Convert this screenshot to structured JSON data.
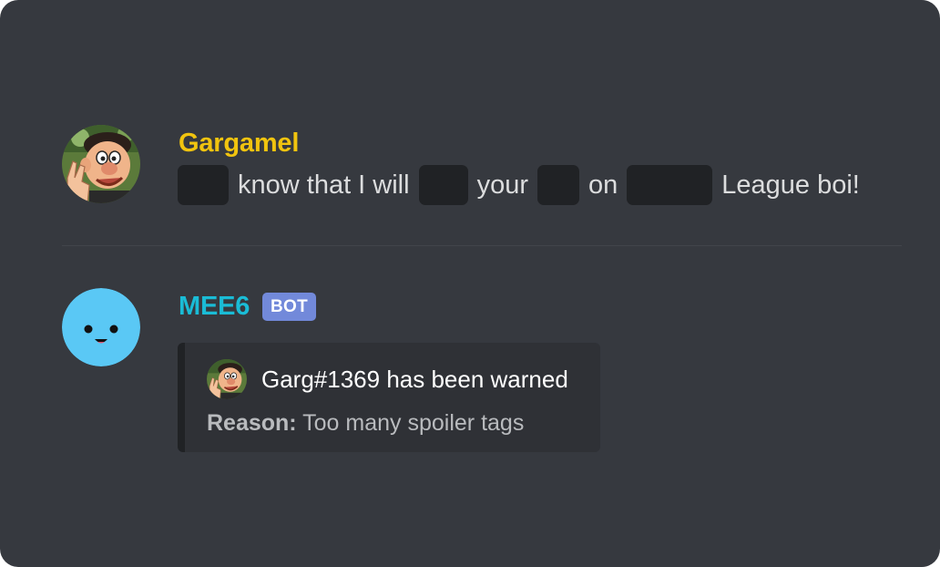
{
  "colors": {
    "background": "#36393f",
    "spoiler": "#202225",
    "gargamel_name": "#f1c40f",
    "mee6_name": "#1abcd6",
    "bot_badge": "#7289da",
    "embed_bg": "#2f3136"
  },
  "messages": [
    {
      "author": "Gargamel",
      "avatar_icon": "gargamel-avatar",
      "text_parts": [
        "know that I will",
        "your",
        "on",
        "League boi!"
      ]
    },
    {
      "author": "MEE6",
      "avatar_icon": "mee6-avatar",
      "badge": "BOT",
      "embed": {
        "author_icon": "gargamel-avatar",
        "author_name": "Garg#1369 has been warned",
        "reason_label": "Reason:",
        "reason_text": "Too many spoiler tags"
      }
    }
  ]
}
